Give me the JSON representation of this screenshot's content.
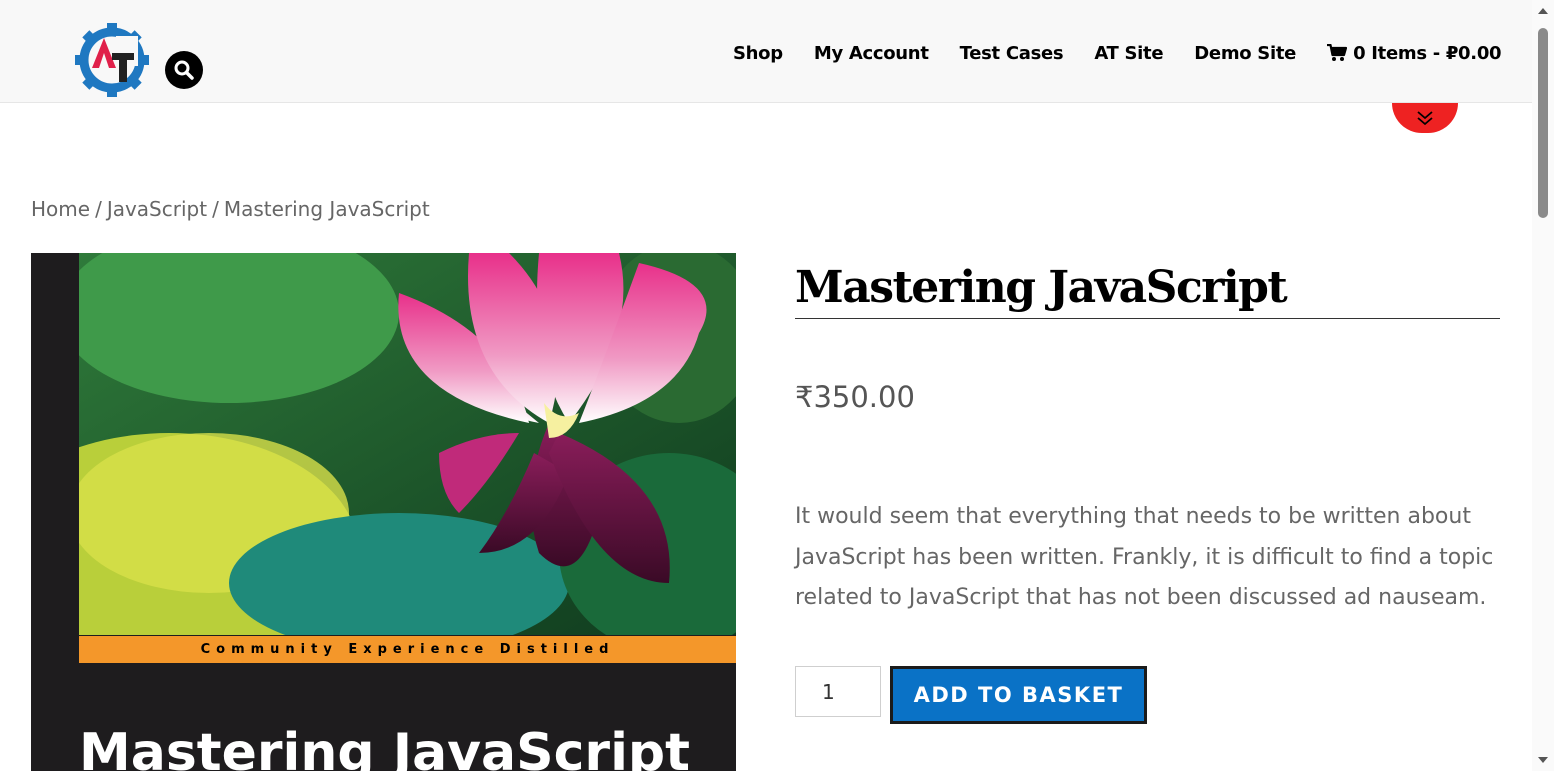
{
  "header": {
    "nav": [
      {
        "label": "Shop"
      },
      {
        "label": "My Account"
      },
      {
        "label": "Test Cases"
      },
      {
        "label": "AT Site"
      },
      {
        "label": "Demo Site"
      }
    ],
    "cart_label": "0 Items - ₽0.00",
    "logo_text": "AT"
  },
  "breadcrumb": {
    "items": [
      "Home",
      "JavaScript",
      "Mastering JavaScript"
    ],
    "separator": "/"
  },
  "product": {
    "title": "Mastering JavaScript",
    "price": "₹350.00",
    "description": "It would seem that everything that needs to be written about JavaScript has been written. Frankly, it is difficult to find a topic related to JavaScript that has not been discussed ad nauseam.",
    "quantity": "1",
    "add_button": "ADD TO BASKET",
    "cover": {
      "band_text": "Community Experience Distilled",
      "title": "Mastering JavaScript"
    }
  },
  "icons": {
    "search": "search-icon",
    "cart": "cart-icon",
    "toggle": "double-chevron-down-icon",
    "logo": "gear-logo-icon"
  },
  "colors": {
    "accent_blue": "#0a72c6",
    "toggle_red": "#ee2222",
    "cover_orange": "#f4972a",
    "logo_blue": "#1f78c1",
    "logo_red": "#e0204a"
  }
}
